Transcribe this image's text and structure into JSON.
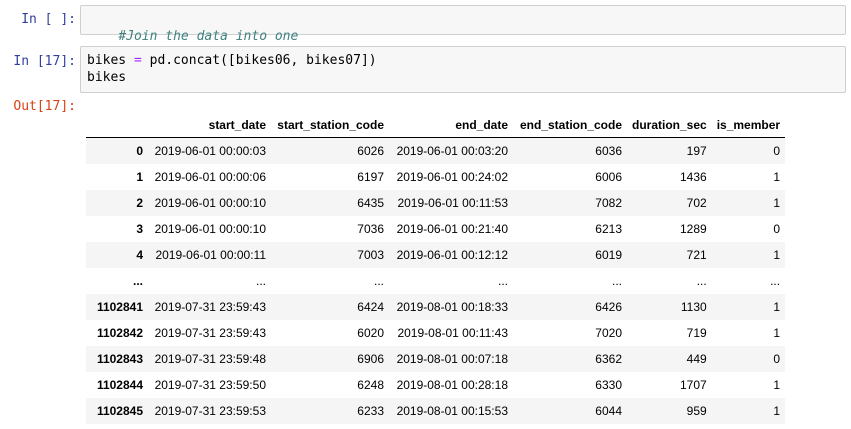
{
  "cell1": {
    "prompt": "In [ ]:",
    "code": "#Join the data into one"
  },
  "cell2": {
    "prompt": "In [17]:",
    "code_tokens": [
      "bikes",
      " = ",
      "pd.concat([bikes06, bikes07])"
    ],
    "code_line2": "bikes"
  },
  "output": {
    "prompt": "Out[17]:",
    "columns": [
      "",
      "start_date",
      "start_station_code",
      "end_date",
      "end_station_code",
      "duration_sec",
      "is_member"
    ],
    "rows": [
      [
        "0",
        "2019-06-01 00:00:03",
        "6026",
        "2019-06-01 00:03:20",
        "6036",
        "197",
        "0"
      ],
      [
        "1",
        "2019-06-01 00:00:06",
        "6197",
        "2019-06-01 00:24:02",
        "6006",
        "1436",
        "1"
      ],
      [
        "2",
        "2019-06-01 00:00:10",
        "6435",
        "2019-06-01 00:11:53",
        "7082",
        "702",
        "1"
      ],
      [
        "3",
        "2019-06-01 00:00:10",
        "7036",
        "2019-06-01 00:21:40",
        "6213",
        "1289",
        "0"
      ],
      [
        "4",
        "2019-06-01 00:00:11",
        "7003",
        "2019-06-01 00:12:12",
        "6019",
        "721",
        "1"
      ],
      [
        "...",
        "...",
        "...",
        "...",
        "...",
        "...",
        "..."
      ],
      [
        "1102841",
        "2019-07-31 23:59:43",
        "6424",
        "2019-08-01 00:18:33",
        "6426",
        "1130",
        "1"
      ],
      [
        "1102842",
        "2019-07-31 23:59:43",
        "6020",
        "2019-08-01 00:11:43",
        "7020",
        "719",
        "1"
      ],
      [
        "1102843",
        "2019-07-31 23:59:48",
        "6906",
        "2019-08-01 00:07:18",
        "6362",
        "449",
        "0"
      ],
      [
        "1102844",
        "2019-07-31 23:59:50",
        "6248",
        "2019-08-01 00:28:18",
        "6330",
        "1707",
        "1"
      ],
      [
        "1102845",
        "2019-07-31 23:59:53",
        "6233",
        "2019-08-01 00:15:53",
        "6044",
        "959",
        "1"
      ]
    ]
  }
}
